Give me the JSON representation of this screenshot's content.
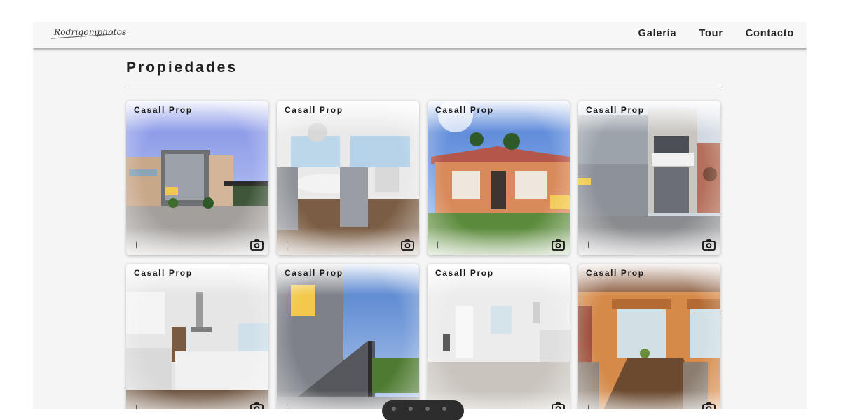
{
  "header": {
    "logo": "Rodrigomphotos",
    "nav": [
      "Galería",
      "Tour",
      "Contacto"
    ]
  },
  "main": {
    "title": "Propiedades",
    "properties": [
      {
        "agency": "Casall Prop",
        "scene": "modern-house-exterior"
      },
      {
        "agency": "Casall Prop",
        "scene": "dining-room-sea-view"
      },
      {
        "agency": "Casall Prop",
        "scene": "orange-house-garden"
      },
      {
        "agency": "Casall Prop",
        "scene": "storefront-building"
      },
      {
        "agency": "Casall Prop",
        "scene": "kitchen-island"
      },
      {
        "agency": "Casall Prop",
        "scene": "exterior-staircase"
      },
      {
        "agency": "Casall Prop",
        "scene": "empty-living-room"
      },
      {
        "agency": "Casall Prop",
        "scene": "dining-table-orange-walls"
      }
    ]
  },
  "icons": {
    "card_action": "camera-icon"
  },
  "colors": {
    "background": "#f5f5f5",
    "text": "#222222",
    "pill": "#2d2d2d"
  }
}
